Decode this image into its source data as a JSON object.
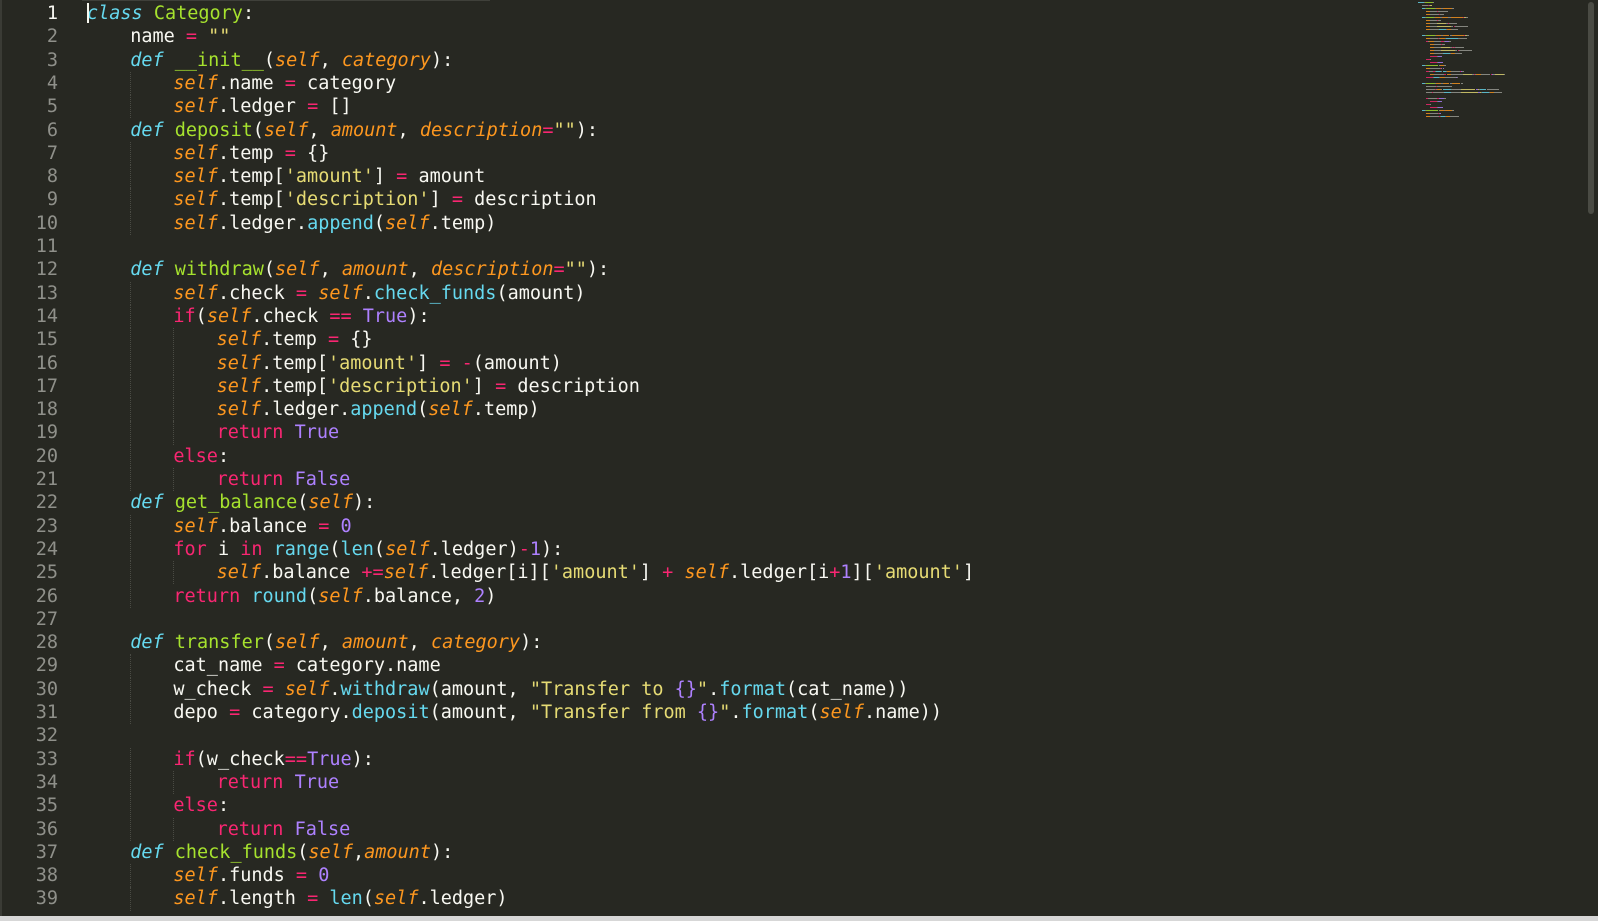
{
  "editor": {
    "active_line": 1,
    "colors": {
      "background": "#272822",
      "foreground": "#f8f8f2",
      "keyword": "#f92672",
      "storage": "#66d9ef",
      "function": "#a6e22e",
      "parameter": "#fd971f",
      "string": "#e6db74",
      "number": "#ae81ff",
      "line_number": "#8f908a"
    },
    "lines": [
      {
        "n": "1",
        "indent": 0,
        "t": [
          [
            "storage",
            "class"
          ],
          [
            "plain",
            " "
          ],
          [
            "func",
            "Category"
          ],
          [
            "plain",
            ":"
          ]
        ]
      },
      {
        "n": "2",
        "indent": 1,
        "t": [
          [
            "plain",
            "name "
          ],
          [
            "kw",
            "="
          ],
          [
            "plain",
            " "
          ],
          [
            "string",
            "\"\""
          ]
        ]
      },
      {
        "n": "3",
        "indent": 1,
        "t": [
          [
            "storage",
            "def"
          ],
          [
            "plain",
            " "
          ],
          [
            "func",
            "__init__"
          ],
          [
            "plain",
            "("
          ],
          [
            "param",
            "self"
          ],
          [
            "plain",
            ", "
          ],
          [
            "param",
            "category"
          ],
          [
            "plain",
            "):"
          ]
        ]
      },
      {
        "n": "4",
        "indent": 2,
        "t": [
          [
            "self",
            "self"
          ],
          [
            "plain",
            ".name "
          ],
          [
            "kw",
            "="
          ],
          [
            "plain",
            " category"
          ]
        ]
      },
      {
        "n": "5",
        "indent": 2,
        "t": [
          [
            "self",
            "self"
          ],
          [
            "plain",
            ".ledger "
          ],
          [
            "kw",
            "="
          ],
          [
            "plain",
            " []"
          ]
        ]
      },
      {
        "n": "6",
        "indent": 1,
        "t": [
          [
            "storage",
            "def"
          ],
          [
            "plain",
            " "
          ],
          [
            "func",
            "deposit"
          ],
          [
            "plain",
            "("
          ],
          [
            "param",
            "self"
          ],
          [
            "plain",
            ", "
          ],
          [
            "param",
            "amount"
          ],
          [
            "plain",
            ", "
          ],
          [
            "param",
            "description"
          ],
          [
            "kw",
            "="
          ],
          [
            "string",
            "\"\""
          ],
          [
            "plain",
            "):"
          ]
        ]
      },
      {
        "n": "7",
        "indent": 2,
        "t": [
          [
            "self",
            "self"
          ],
          [
            "plain",
            ".temp "
          ],
          [
            "kw",
            "="
          ],
          [
            "plain",
            " {}"
          ]
        ]
      },
      {
        "n": "8",
        "indent": 2,
        "t": [
          [
            "self",
            "self"
          ],
          [
            "plain",
            ".temp["
          ],
          [
            "string",
            "'amount'"
          ],
          [
            "plain",
            "] "
          ],
          [
            "kw",
            "="
          ],
          [
            "plain",
            " amount"
          ]
        ]
      },
      {
        "n": "9",
        "indent": 2,
        "t": [
          [
            "self",
            "self"
          ],
          [
            "plain",
            ".temp["
          ],
          [
            "string",
            "'description'"
          ],
          [
            "plain",
            "] "
          ],
          [
            "kw",
            "="
          ],
          [
            "plain",
            " description"
          ]
        ]
      },
      {
        "n": "10",
        "indent": 2,
        "t": [
          [
            "self",
            "self"
          ],
          [
            "plain",
            ".ledger."
          ],
          [
            "builtin",
            "append"
          ],
          [
            "plain",
            "("
          ],
          [
            "self",
            "self"
          ],
          [
            "plain",
            ".temp)"
          ]
        ]
      },
      {
        "n": "11",
        "indent": 0,
        "t": []
      },
      {
        "n": "12",
        "indent": 1,
        "t": [
          [
            "storage",
            "def"
          ],
          [
            "plain",
            " "
          ],
          [
            "func",
            "withdraw"
          ],
          [
            "plain",
            "("
          ],
          [
            "param",
            "self"
          ],
          [
            "plain",
            ", "
          ],
          [
            "param",
            "amount"
          ],
          [
            "plain",
            ", "
          ],
          [
            "param",
            "description"
          ],
          [
            "kw",
            "="
          ],
          [
            "string",
            "\"\""
          ],
          [
            "plain",
            "):"
          ]
        ]
      },
      {
        "n": "13",
        "indent": 2,
        "t": [
          [
            "self",
            "self"
          ],
          [
            "plain",
            ".check "
          ],
          [
            "kw",
            "="
          ],
          [
            "plain",
            " "
          ],
          [
            "self",
            "self"
          ],
          [
            "plain",
            "."
          ],
          [
            "builtin",
            "check_funds"
          ],
          [
            "plain",
            "(amount)"
          ]
        ]
      },
      {
        "n": "14",
        "indent": 2,
        "t": [
          [
            "kw",
            "if"
          ],
          [
            "plain",
            "("
          ],
          [
            "self",
            "self"
          ],
          [
            "plain",
            ".check "
          ],
          [
            "kw",
            "=="
          ],
          [
            "plain",
            " "
          ],
          [
            "const",
            "True"
          ],
          [
            "plain",
            "):"
          ]
        ]
      },
      {
        "n": "15",
        "indent": 3,
        "t": [
          [
            "self",
            "self"
          ],
          [
            "plain",
            ".temp "
          ],
          [
            "kw",
            "="
          ],
          [
            "plain",
            " {}"
          ]
        ]
      },
      {
        "n": "16",
        "indent": 3,
        "t": [
          [
            "self",
            "self"
          ],
          [
            "plain",
            ".temp["
          ],
          [
            "string",
            "'amount'"
          ],
          [
            "plain",
            "] "
          ],
          [
            "kw",
            "="
          ],
          [
            "plain",
            " "
          ],
          [
            "kw",
            "-"
          ],
          [
            "plain",
            "(amount)"
          ]
        ]
      },
      {
        "n": "17",
        "indent": 3,
        "t": [
          [
            "self",
            "self"
          ],
          [
            "plain",
            ".temp["
          ],
          [
            "string",
            "'description'"
          ],
          [
            "plain",
            "] "
          ],
          [
            "kw",
            "="
          ],
          [
            "plain",
            " description"
          ]
        ]
      },
      {
        "n": "18",
        "indent": 3,
        "t": [
          [
            "self",
            "self"
          ],
          [
            "plain",
            ".ledger."
          ],
          [
            "builtin",
            "append"
          ],
          [
            "plain",
            "("
          ],
          [
            "self",
            "self"
          ],
          [
            "plain",
            ".temp)"
          ]
        ]
      },
      {
        "n": "19",
        "indent": 3,
        "t": [
          [
            "kw",
            "return"
          ],
          [
            "plain",
            " "
          ],
          [
            "const",
            "True"
          ]
        ]
      },
      {
        "n": "20",
        "indent": 2,
        "t": [
          [
            "kw",
            "else"
          ],
          [
            "plain",
            ":"
          ]
        ]
      },
      {
        "n": "21",
        "indent": 3,
        "t": [
          [
            "kw",
            "return"
          ],
          [
            "plain",
            " "
          ],
          [
            "const",
            "False"
          ]
        ]
      },
      {
        "n": "22",
        "indent": 1,
        "t": [
          [
            "storage",
            "def"
          ],
          [
            "plain",
            " "
          ],
          [
            "func",
            "get_balance"
          ],
          [
            "plain",
            "("
          ],
          [
            "param",
            "self"
          ],
          [
            "plain",
            "):"
          ]
        ]
      },
      {
        "n": "23",
        "indent": 2,
        "t": [
          [
            "self",
            "self"
          ],
          [
            "plain",
            ".balance "
          ],
          [
            "kw",
            "="
          ],
          [
            "plain",
            " "
          ],
          [
            "num",
            "0"
          ]
        ]
      },
      {
        "n": "24",
        "indent": 2,
        "t": [
          [
            "kw",
            "for"
          ],
          [
            "plain",
            " i "
          ],
          [
            "kw",
            "in"
          ],
          [
            "plain",
            " "
          ],
          [
            "builtin",
            "range"
          ],
          [
            "plain",
            "("
          ],
          [
            "builtin",
            "len"
          ],
          [
            "plain",
            "("
          ],
          [
            "self",
            "self"
          ],
          [
            "plain",
            ".ledger)"
          ],
          [
            "kw",
            "-"
          ],
          [
            "num",
            "1"
          ],
          [
            "plain",
            "):"
          ]
        ]
      },
      {
        "n": "25",
        "indent": 3,
        "t": [
          [
            "self",
            "self"
          ],
          [
            "plain",
            ".balance "
          ],
          [
            "kw",
            "+="
          ],
          [
            "self",
            "self"
          ],
          [
            "plain",
            ".ledger[i]["
          ],
          [
            "string",
            "'amount'"
          ],
          [
            "plain",
            "] "
          ],
          [
            "kw",
            "+"
          ],
          [
            "plain",
            " "
          ],
          [
            "self",
            "self"
          ],
          [
            "plain",
            ".ledger[i"
          ],
          [
            "kw",
            "+"
          ],
          [
            "num",
            "1"
          ],
          [
            "plain",
            "]["
          ],
          [
            "string",
            "'amount'"
          ],
          [
            "plain",
            "]"
          ]
        ]
      },
      {
        "n": "26",
        "indent": 2,
        "t": [
          [
            "kw",
            "return"
          ],
          [
            "plain",
            " "
          ],
          [
            "builtin",
            "round"
          ],
          [
            "plain",
            "("
          ],
          [
            "self",
            "self"
          ],
          [
            "plain",
            ".balance, "
          ],
          [
            "num",
            "2"
          ],
          [
            "plain",
            ")"
          ]
        ]
      },
      {
        "n": "27",
        "indent": 0,
        "t": []
      },
      {
        "n": "28",
        "indent": 1,
        "t": [
          [
            "storage",
            "def"
          ],
          [
            "plain",
            " "
          ],
          [
            "func",
            "transfer"
          ],
          [
            "plain",
            "("
          ],
          [
            "param",
            "self"
          ],
          [
            "plain",
            ", "
          ],
          [
            "param",
            "amount"
          ],
          [
            "plain",
            ", "
          ],
          [
            "param",
            "category"
          ],
          [
            "plain",
            "):"
          ]
        ]
      },
      {
        "n": "29",
        "indent": 2,
        "t": [
          [
            "plain",
            "cat_name "
          ],
          [
            "kw",
            "="
          ],
          [
            "plain",
            " category.name"
          ]
        ]
      },
      {
        "n": "30",
        "indent": 2,
        "t": [
          [
            "plain",
            "w_check "
          ],
          [
            "kw",
            "="
          ],
          [
            "plain",
            " "
          ],
          [
            "self",
            "self"
          ],
          [
            "plain",
            "."
          ],
          [
            "builtin",
            "withdraw"
          ],
          [
            "plain",
            "(amount, "
          ],
          [
            "string",
            "\"Transfer to "
          ],
          [
            "num",
            "{}"
          ],
          [
            "string",
            "\""
          ],
          [
            "plain",
            "."
          ],
          [
            "builtin",
            "format"
          ],
          [
            "plain",
            "(cat_name))"
          ]
        ]
      },
      {
        "n": "31",
        "indent": 2,
        "t": [
          [
            "plain",
            "depo "
          ],
          [
            "kw",
            "="
          ],
          [
            "plain",
            " category."
          ],
          [
            "builtin",
            "deposit"
          ],
          [
            "plain",
            "(amount, "
          ],
          [
            "string",
            "\"Transfer from "
          ],
          [
            "num",
            "{}"
          ],
          [
            "string",
            "\""
          ],
          [
            "plain",
            "."
          ],
          [
            "builtin",
            "format"
          ],
          [
            "plain",
            "("
          ],
          [
            "self",
            "self"
          ],
          [
            "plain",
            ".name))"
          ]
        ]
      },
      {
        "n": "32",
        "indent": 0,
        "t": []
      },
      {
        "n": "33",
        "indent": 2,
        "t": [
          [
            "kw",
            "if"
          ],
          [
            "plain",
            "(w_check"
          ],
          [
            "kw",
            "=="
          ],
          [
            "const",
            "True"
          ],
          [
            "plain",
            "):"
          ]
        ]
      },
      {
        "n": "34",
        "indent": 3,
        "t": [
          [
            "kw",
            "return"
          ],
          [
            "plain",
            " "
          ],
          [
            "const",
            "True"
          ]
        ]
      },
      {
        "n": "35",
        "indent": 2,
        "t": [
          [
            "kw",
            "else"
          ],
          [
            "plain",
            ":"
          ]
        ]
      },
      {
        "n": "36",
        "indent": 3,
        "t": [
          [
            "kw",
            "return"
          ],
          [
            "plain",
            " "
          ],
          [
            "const",
            "False"
          ]
        ]
      },
      {
        "n": "37",
        "indent": 1,
        "t": [
          [
            "storage",
            "def"
          ],
          [
            "plain",
            " "
          ],
          [
            "func",
            "check_funds"
          ],
          [
            "plain",
            "("
          ],
          [
            "param",
            "self"
          ],
          [
            "plain",
            ","
          ],
          [
            "param",
            "amount"
          ],
          [
            "plain",
            "):"
          ]
        ]
      },
      {
        "n": "38",
        "indent": 2,
        "t": [
          [
            "self",
            "self"
          ],
          [
            "plain",
            ".funds "
          ],
          [
            "kw",
            "="
          ],
          [
            "plain",
            " "
          ],
          [
            "num",
            "0"
          ]
        ]
      },
      {
        "n": "39",
        "indent": 2,
        "t": [
          [
            "self",
            "self"
          ],
          [
            "plain",
            ".length "
          ],
          [
            "kw",
            "="
          ],
          [
            "plain",
            " "
          ],
          [
            "builtin",
            "len"
          ],
          [
            "plain",
            "("
          ],
          [
            "self",
            "self"
          ],
          [
            "plain",
            ".ledger)"
          ]
        ]
      }
    ]
  }
}
